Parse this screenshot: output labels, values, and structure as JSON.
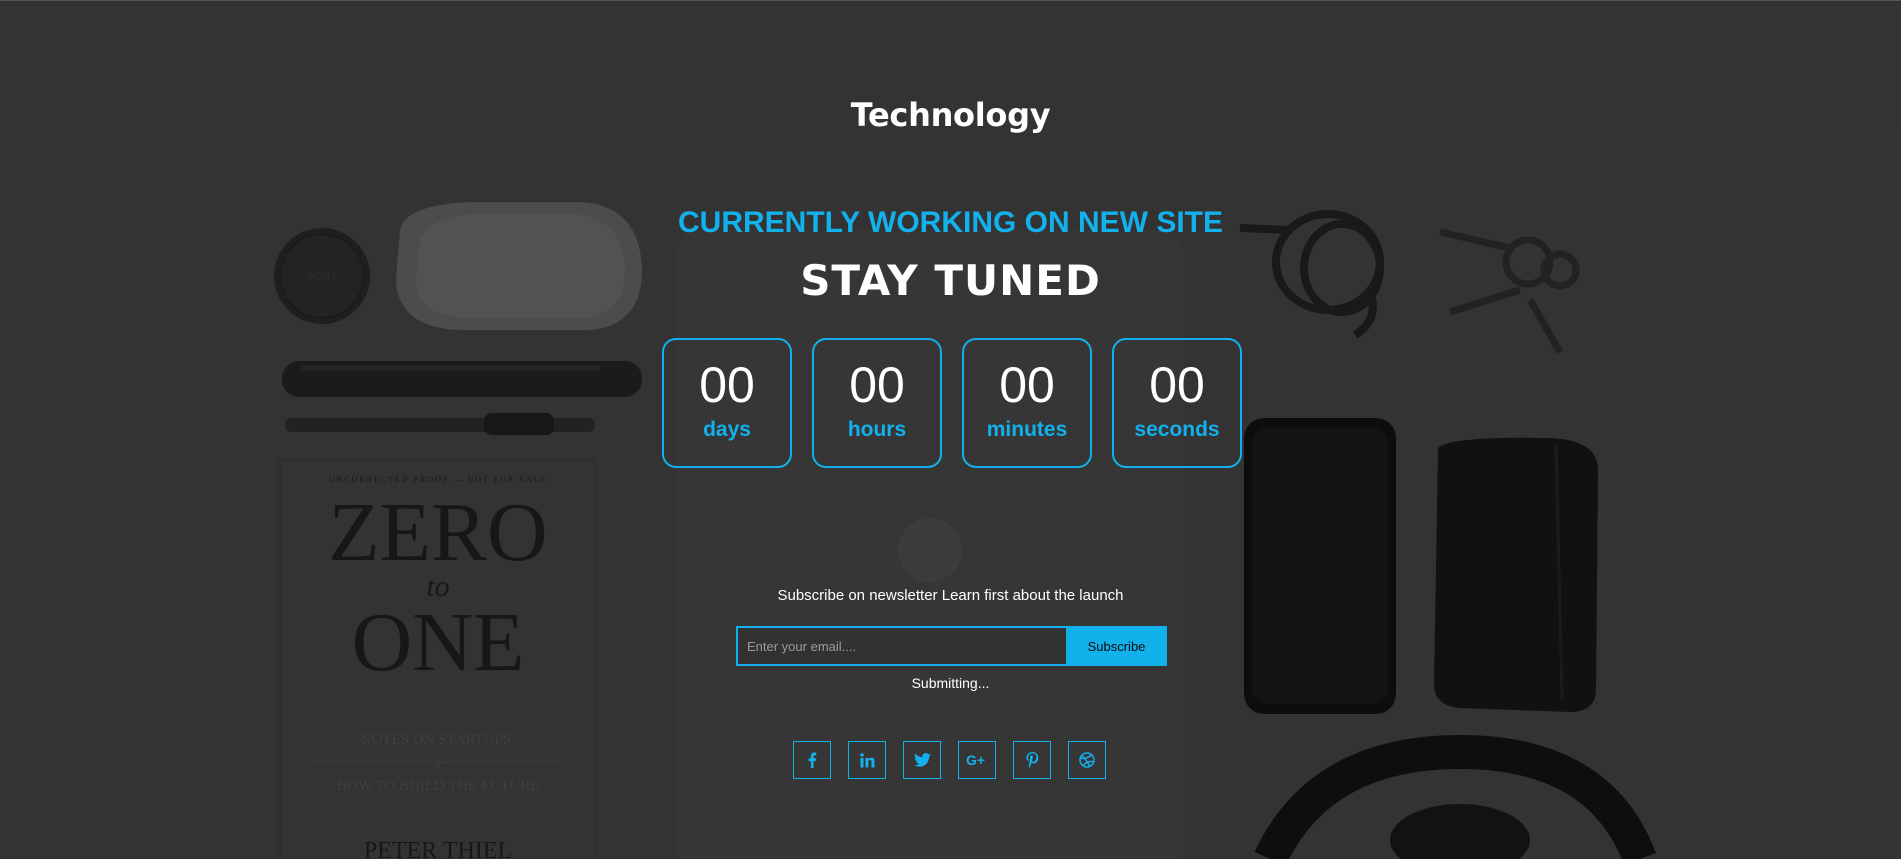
{
  "brand": {
    "title": "Technology"
  },
  "hero": {
    "working": "CURRENTLY WORKING ON NEW SITE",
    "stay_tuned": "STAY TUNED"
  },
  "countdown": [
    {
      "value": "00",
      "label": "days"
    },
    {
      "value": "00",
      "label": "hours"
    },
    {
      "value": "00",
      "label": "minutes"
    },
    {
      "value": "00",
      "label": "seconds"
    }
  ],
  "newsletter": {
    "text": "Subscribe on newsletter Learn first about the launch",
    "email_placeholder": "Enter your email....",
    "email_value": "",
    "button_label": "Subscribe",
    "status": "Submitting..."
  },
  "social": [
    {
      "icon": "facebook-icon",
      "glyph": "f"
    },
    {
      "icon": "linkedin-icon",
      "glyph": "in"
    },
    {
      "icon": "twitter-icon",
      "glyph": ""
    },
    {
      "icon": "google-plus-icon",
      "glyph": "G+"
    },
    {
      "icon": "pinterest-icon",
      "glyph": ""
    },
    {
      "icon": "dribbble-icon",
      "glyph": ""
    }
  ],
  "background": {
    "book": {
      "top_line": "UNCORRECTED PROOF — NOT FOR SALE",
      "title_1": "ZERO",
      "title_2": "to",
      "title_3": "ONE",
      "subtitle_1": "NOTES ON STARTUPS,",
      "subtitle_2": "or",
      "subtitle_3": "HOW TO BUILD THE FUTURE",
      "author": "PETER THIEL"
    },
    "lens_cap_text": "SONY"
  },
  "colors": {
    "accent": "#12b1ec",
    "overlay": "#3f3f3f",
    "text": "#ffffff"
  }
}
